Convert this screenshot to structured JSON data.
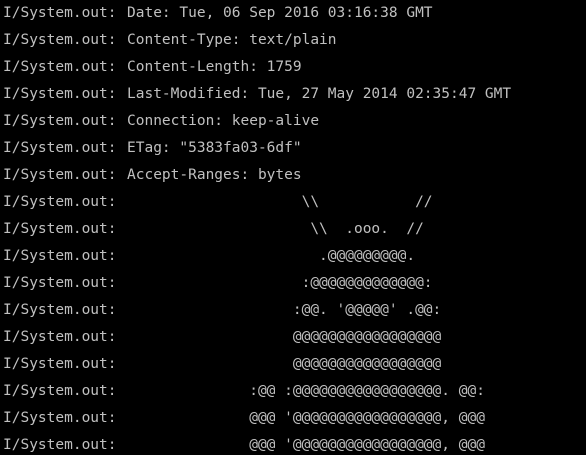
{
  "console": {
    "lines": [
      {
        "tag": "I/System.out:",
        "message": "Date: Tue, 06 Sep 2016 03:16:38 GMT"
      },
      {
        "tag": "I/System.out:",
        "message": "Content-Type: text/plain"
      },
      {
        "tag": "I/System.out:",
        "message": "Content-Length: 1759"
      },
      {
        "tag": "I/System.out:",
        "message": "Last-Modified: Tue, 27 May 2014 02:35:47 GMT"
      },
      {
        "tag": "I/System.out:",
        "message": "Connection: keep-alive"
      },
      {
        "tag": "I/System.out:",
        "message": "ETag: \"5383fa03-6df\""
      },
      {
        "tag": "I/System.out:",
        "message": "Accept-Ranges: bytes"
      },
      {
        "tag": "I/System.out:",
        "message": "                    \\\\           //"
      },
      {
        "tag": "I/System.out:",
        "message": "                     \\\\  .ooo.  //"
      },
      {
        "tag": "I/System.out:",
        "message": "                      .@@@@@@@@@."
      },
      {
        "tag": "I/System.out:",
        "message": "                    :@@@@@@@@@@@@@:"
      },
      {
        "tag": "I/System.out:",
        "message": "                   :@@. '@@@@@' .@@:"
      },
      {
        "tag": "I/System.out:",
        "message": "                   @@@@@@@@@@@@@@@@@"
      },
      {
        "tag": "I/System.out:",
        "message": "                   @@@@@@@@@@@@@@@@@"
      },
      {
        "tag": "I/System.out:",
        "message": "              :@@ :@@@@@@@@@@@@@@@@@. @@:"
      },
      {
        "tag": "I/System.out:",
        "message": "              @@@ '@@@@@@@@@@@@@@@@@, @@@"
      },
      {
        "tag": "I/System.out:",
        "message": "              @@@ '@@@@@@@@@@@@@@@@@, @@@"
      }
    ]
  },
  "colors": {
    "background": "#000000",
    "text": "#c0c0c0"
  }
}
